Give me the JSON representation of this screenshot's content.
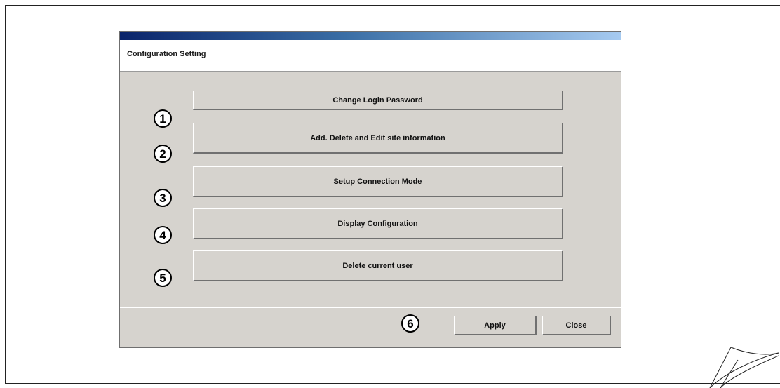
{
  "dialog": {
    "title": "Configuration Setting",
    "buttons": [
      {
        "label": "Change Login Password"
      },
      {
        "label": "Add. Delete and Edit site information"
      },
      {
        "label": "Setup Connection Mode"
      },
      {
        "label": "Display Configuration"
      },
      {
        "label": "Delete current user"
      }
    ],
    "apply_label": "Apply",
    "close_label": "Close"
  },
  "callouts": [
    "1",
    "2",
    "3",
    "4",
    "5",
    "6"
  ],
  "colors": {
    "titlebar_start": "#0a246a",
    "titlebar_end": "#a6caf0",
    "dialog_face": "#d6d3ce",
    "header_bg": "#ffffff"
  }
}
